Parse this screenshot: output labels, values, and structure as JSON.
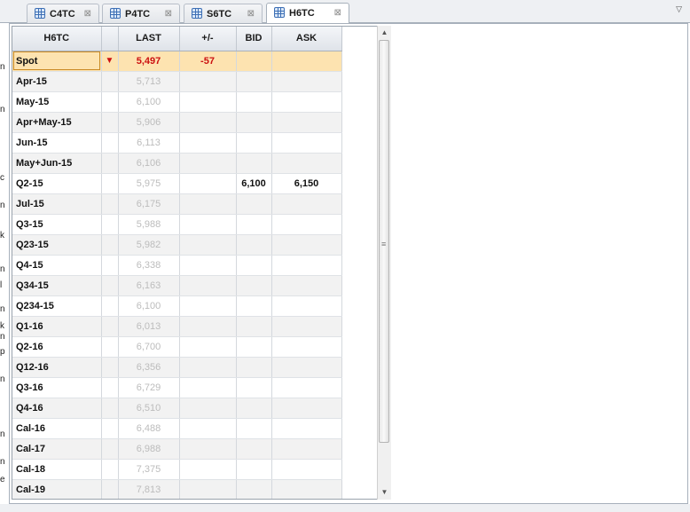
{
  "tabs": [
    {
      "label": "C4TC",
      "active": false
    },
    {
      "label": "P4TC",
      "active": false
    },
    {
      "label": "S6TC",
      "active": false
    },
    {
      "label": "H6TC",
      "active": true
    }
  ],
  "tab_close_glyph": "⊠",
  "tab_menu_glyph": "▽",
  "left_sliver_chars": [
    "n",
    "n",
    "c",
    "n",
    "k",
    "n",
    "l",
    "n",
    "k",
    "n",
    "p",
    "n",
    "n",
    "n",
    "e"
  ],
  "grid": {
    "columns": [
      "H6TC",
      "",
      "LAST",
      "+/-",
      "BID",
      "ASK"
    ],
    "rows": [
      {
        "name": "Spot",
        "arrow": "▼",
        "last": "5,497",
        "change": "-57",
        "bid": "",
        "ask": ""
      },
      {
        "name": "Apr-15",
        "arrow": "",
        "last": "5,713",
        "change": "",
        "bid": "",
        "ask": ""
      },
      {
        "name": "May-15",
        "arrow": "",
        "last": "6,100",
        "change": "",
        "bid": "",
        "ask": ""
      },
      {
        "name": "Apr+May-15",
        "arrow": "",
        "last": "5,906",
        "change": "",
        "bid": "",
        "ask": ""
      },
      {
        "name": "Jun-15",
        "arrow": "",
        "last": "6,113",
        "change": "",
        "bid": "",
        "ask": ""
      },
      {
        "name": "May+Jun-15",
        "arrow": "",
        "last": "6,106",
        "change": "",
        "bid": "",
        "ask": ""
      },
      {
        "name": "Q2-15",
        "arrow": "",
        "last": "5,975",
        "change": "",
        "bid": "6,100",
        "ask": "6,150"
      },
      {
        "name": "Jul-15",
        "arrow": "",
        "last": "6,175",
        "change": "",
        "bid": "",
        "ask": ""
      },
      {
        "name": "Q3-15",
        "arrow": "",
        "last": "5,988",
        "change": "",
        "bid": "",
        "ask": ""
      },
      {
        "name": "Q23-15",
        "arrow": "",
        "last": "5,982",
        "change": "",
        "bid": "",
        "ask": ""
      },
      {
        "name": "Q4-15",
        "arrow": "",
        "last": "6,338",
        "change": "",
        "bid": "",
        "ask": ""
      },
      {
        "name": "Q34-15",
        "arrow": "",
        "last": "6,163",
        "change": "",
        "bid": "",
        "ask": ""
      },
      {
        "name": "Q234-15",
        "arrow": "",
        "last": "6,100",
        "change": "",
        "bid": "",
        "ask": ""
      },
      {
        "name": "Q1-16",
        "arrow": "",
        "last": "6,013",
        "change": "",
        "bid": "",
        "ask": ""
      },
      {
        "name": "Q2-16",
        "arrow": "",
        "last": "6,700",
        "change": "",
        "bid": "",
        "ask": ""
      },
      {
        "name": "Q12-16",
        "arrow": "",
        "last": "6,356",
        "change": "",
        "bid": "",
        "ask": ""
      },
      {
        "name": "Q3-16",
        "arrow": "",
        "last": "6,729",
        "change": "",
        "bid": "",
        "ask": ""
      },
      {
        "name": "Q4-16",
        "arrow": "",
        "last": "6,510",
        "change": "",
        "bid": "",
        "ask": ""
      },
      {
        "name": "Cal-16",
        "arrow": "",
        "last": "6,488",
        "change": "",
        "bid": "",
        "ask": ""
      },
      {
        "name": "Cal-17",
        "arrow": "",
        "last": "6,988",
        "change": "",
        "bid": "",
        "ask": ""
      },
      {
        "name": "Cal-18",
        "arrow": "",
        "last": "7,375",
        "change": "",
        "bid": "",
        "ask": ""
      },
      {
        "name": "Cal-19",
        "arrow": "",
        "last": "7,813",
        "change": "",
        "bid": "",
        "ask": ""
      }
    ]
  },
  "scrollbar": {
    "up_glyph": "▲",
    "down_glyph": "▼",
    "grip_glyph": "≡"
  },
  "colors": {
    "spot_highlight": "#fde3b0",
    "down_red": "#cc1111",
    "stale_grey": "#bcbcbc",
    "tab_icon_blue": "#3d6fb5"
  }
}
